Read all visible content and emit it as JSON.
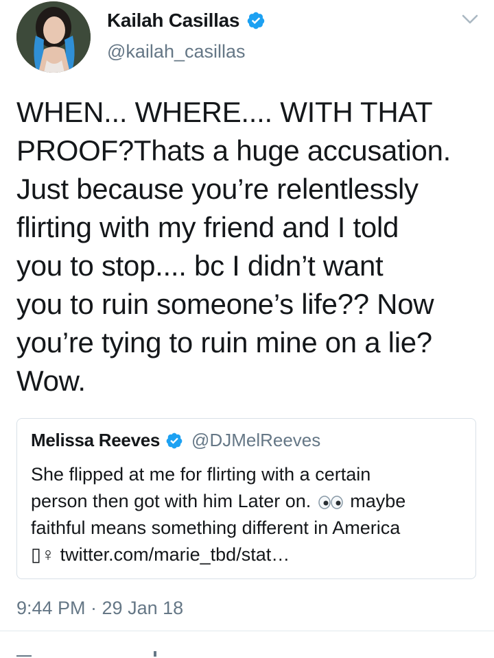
{
  "author": {
    "display_name": "Kailah Casillas",
    "handle": "@kailah_casillas",
    "verified": true,
    "avatar_icon": "profile-photo-avatar"
  },
  "menu_icon": "chevron-down-icon",
  "tweet": {
    "lines": [
      "WHEN... WHERE.... WITH THAT",
      "PROOF?Thats a huge accusation.",
      "Just because you’re relentlessly",
      "flirting with my friend and I told",
      "you to stop.... bc I didn’t want",
      "you to ruin someone’s life?? Now",
      "you’re tying to ruin mine on a lie?",
      "Wow."
    ],
    "timestamp": "9:44 PM · 29 Jan 18"
  },
  "quoted_tweet": {
    "display_name": "Melissa Reeves",
    "handle": "@DJMelReeves",
    "verified": true,
    "line1": "She flipped at me for flirting with a certain",
    "line2_before_emoji": "person then got with him Later on. ",
    "line2_after_emoji": " maybe",
    "line3": "faithful means something different in America",
    "line4_prefix": "▯♀",
    "line4_link": " twitter.com/marie_tbd/stat…"
  },
  "colors": {
    "verified_blue": "#1da1f2",
    "secondary_text": "#657786",
    "border": "#d8e0e7"
  }
}
